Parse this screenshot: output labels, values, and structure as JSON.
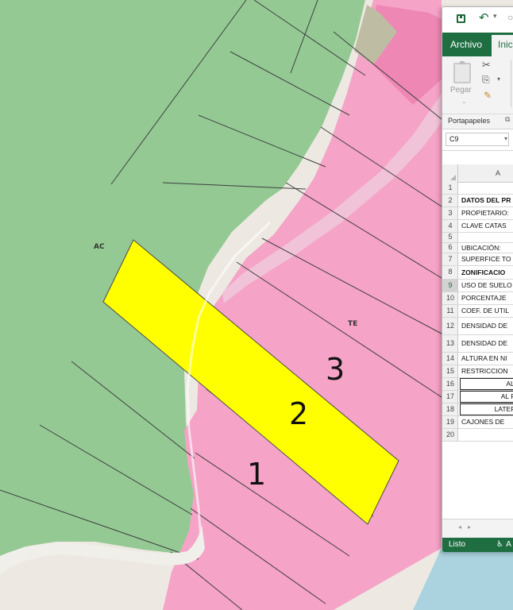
{
  "map": {
    "zones": [
      {
        "label": "AC",
        "color": "#94c994"
      },
      {
        "label": "TE",
        "color": "#f5a3c7"
      }
    ],
    "highlight_color": "#ffff00",
    "lot_numbers": [
      "1",
      "2",
      "3"
    ]
  },
  "excel": {
    "tabs": {
      "archivo": "Archivo",
      "inicio": "Inic"
    },
    "ribbon": {
      "paste_label": "Pegar",
      "group_label": "Portapapeles"
    },
    "name_box": "C9",
    "column_header": "A",
    "selected_row": "9",
    "rows": [
      {
        "num": "1",
        "text": ""
      },
      {
        "num": "2",
        "text": "DATOS DEL PR"
      },
      {
        "num": "3",
        "text": "PROPIETARIO:"
      },
      {
        "num": "4",
        "text": "CLAVE CATAS"
      },
      {
        "num": "5",
        "text": ""
      },
      {
        "num": "6",
        "text": "UBICACIÓN:"
      },
      {
        "num": "7",
        "text": "SUPERFICE TO"
      },
      {
        "num": "8",
        "text": "ZONIFICACIO"
      },
      {
        "num": "9",
        "text": "USO DE SUELO"
      },
      {
        "num": "10",
        "text": "PORCENTAJE"
      },
      {
        "num": "11",
        "text": "COEF. DE UTIL"
      },
      {
        "num": "12",
        "text": "DENSIDAD DE"
      },
      {
        "num": "13",
        "text": "DENSIDAD DE"
      },
      {
        "num": "14",
        "text": "ALTURA EN NI"
      },
      {
        "num": "15",
        "text": "RESTRICCION"
      },
      {
        "num": "16",
        "text": "AL F"
      },
      {
        "num": "17",
        "text": "AL FO"
      },
      {
        "num": "18",
        "text": "LATERA"
      },
      {
        "num": "19",
        "text": "CAJONES DE"
      },
      {
        "num": "20",
        "text": ""
      }
    ],
    "status": "Listo",
    "accessibility": "A"
  }
}
